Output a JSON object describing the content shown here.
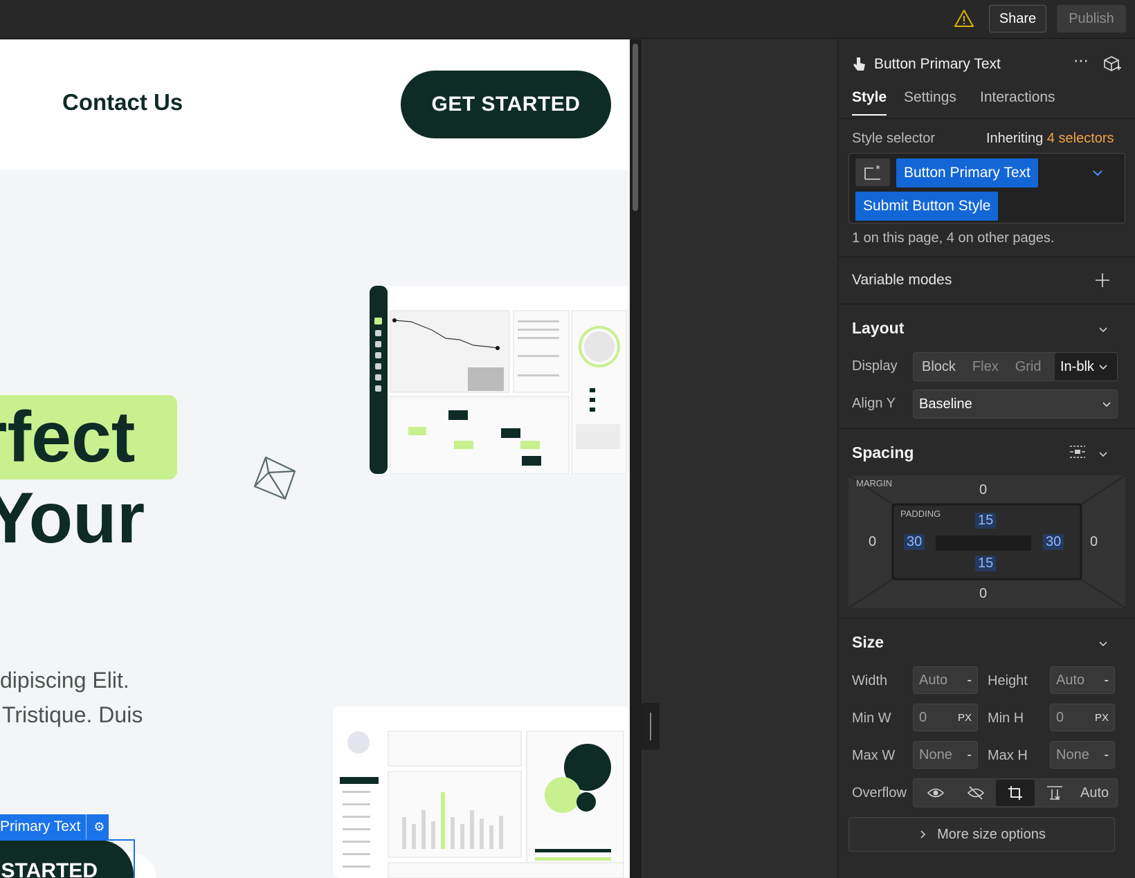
{
  "topbar": {
    "share_label": "Share",
    "publish_label": "Publish"
  },
  "canvas": {
    "nav_link": "Contact Us",
    "cta_label": "GET STARTED",
    "hero_line1": "rfect",
    "hero_line2": "Your",
    "para_line1": "dipiscing Elit.",
    "para_line2": "Tristique. Duis",
    "selected_label": "Primary Text",
    "selected_button_text": "STARTED"
  },
  "panel": {
    "element_name": "Button Primary Text",
    "tabs": [
      {
        "label": "Style",
        "active": true
      },
      {
        "label": "Settings",
        "active": false
      },
      {
        "label": "Interactions",
        "active": false
      }
    ],
    "style_selector_label": "Style selector",
    "inheriting_prefix": "Inheriting",
    "inheriting_count": "4 selectors",
    "selectors": [
      "Button Primary Text",
      "Submit Button Style"
    ],
    "selector_usage": "1 on this page, 4 on other pages.",
    "variable_modes": "Variable modes",
    "layout": {
      "title": "Layout",
      "display_label": "Display",
      "display_options": [
        "Block",
        "Flex",
        "Grid",
        "In-blk"
      ],
      "display_selected": "In-blk",
      "align_y_label": "Align Y",
      "align_y_value": "Baseline"
    },
    "spacing": {
      "title": "Spacing",
      "margin_label": "MARGIN",
      "padding_label": "PADDING",
      "margin": {
        "top": "0",
        "right": "0",
        "bottom": "0",
        "left": "0"
      },
      "padding": {
        "top": "15",
        "right": "30",
        "bottom": "15",
        "left": "30"
      }
    },
    "size": {
      "title": "Size",
      "width_label": "Width",
      "width_value": "Auto",
      "height_label": "Height",
      "height_value": "Auto",
      "minw_label": "Min W",
      "minw_value": "0",
      "minw_unit": "PX",
      "minh_label": "Min H",
      "minh_value": "0",
      "minh_unit": "PX",
      "maxw_label": "Max W",
      "maxw_value": "None",
      "maxh_label": "Max H",
      "maxh_value": "None",
      "overflow_label": "Overflow",
      "overflow_auto": "Auto",
      "more_options": "More size options",
      "unit_dash": "-"
    }
  },
  "colors": {
    "accent_blue": "#1366d6",
    "brand_dark": "#0e2b26",
    "brand_lime": "#c9f08f",
    "warning": "#e0b100",
    "inherit_orange": "#f0a24a"
  }
}
